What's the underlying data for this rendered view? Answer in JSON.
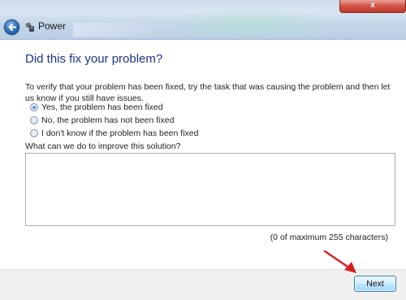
{
  "window": {
    "title": "Power",
    "close_glyph": "x"
  },
  "dialog": {
    "heading": "Did this fix your problem?",
    "instructions": "To verify that your problem has been fixed, try the task that was causing the problem and then let us know if you still have issues.",
    "options": [
      {
        "label": "Yes, the problem has been fixed",
        "checked": true
      },
      {
        "label": "No, the problem has not been fixed",
        "checked": false
      },
      {
        "label": "I don't know if the problem has been fixed",
        "checked": false
      }
    ],
    "improve_label": "What can we do to improve this solution?",
    "improve_value": "",
    "char_count": "(0 of maximum 255 characters)"
  },
  "footer": {
    "next_label": "Next"
  },
  "annotation": {
    "arrow_color": "#d42020"
  }
}
